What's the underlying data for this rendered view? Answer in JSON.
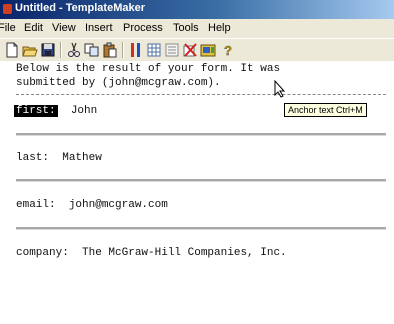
{
  "window": {
    "title": "Untitled - TemplateMaker"
  },
  "menubar": {
    "items": [
      "File",
      "Edit",
      "View",
      "Insert",
      "Process",
      "Tools",
      "Help"
    ]
  },
  "toolbar": {
    "buttons": [
      "new-document-icon",
      "open-folder-icon",
      "save-icon",
      "cut-icon",
      "copy-icon",
      "paste-icon",
      "insert-field-icon",
      "insert-table-icon",
      "insert-list-icon",
      "anchor-text-icon",
      "preview-icon",
      "help-icon"
    ],
    "tooltip": "Anchor text  Ctrl+M"
  },
  "document": {
    "intro_line1": "Below is the result of your form. It was",
    "intro_line2": "submitted by  (john@mcgraw.com).",
    "fields": [
      {
        "label": "first:",
        "value": "John",
        "selected": true
      },
      {
        "label": "last:",
        "value": "Mathew",
        "selected": false
      },
      {
        "label": "email:",
        "value": "john@mcgraw.com",
        "selected": false
      },
      {
        "label": "company:",
        "value": "The McGraw-Hill Companies, Inc.",
        "selected": false
      }
    ]
  }
}
